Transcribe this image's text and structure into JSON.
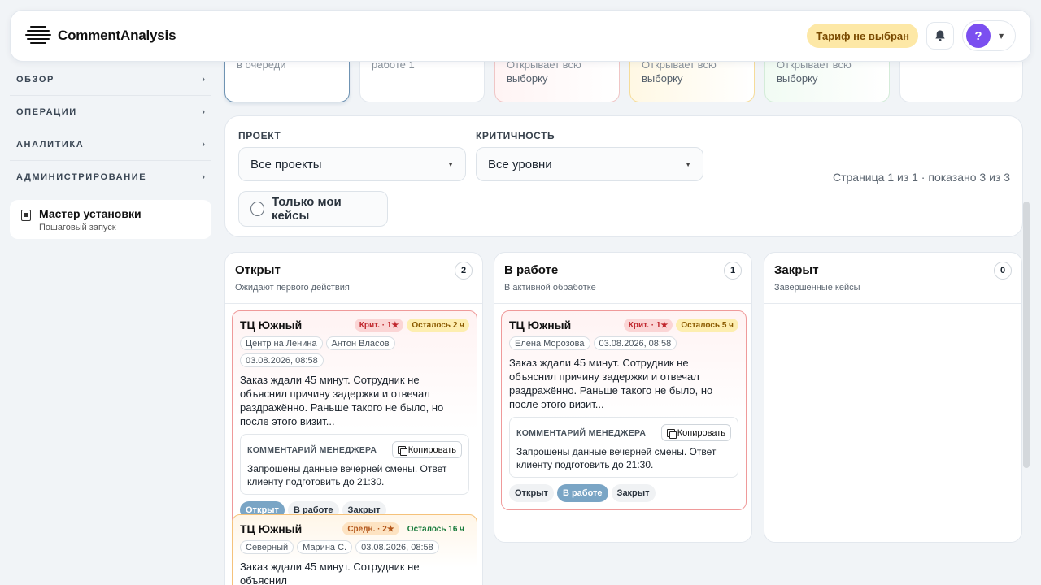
{
  "header": {
    "brand": "CommentAnalysis",
    "tariff": "Тариф не выбран",
    "avatar_letter": "?"
  },
  "sidebar": {
    "items": [
      {
        "label": "ОБЗОР",
        "chevron": "›"
      },
      {
        "label": "ОПЕРАЦИИ",
        "chevron": "›"
      },
      {
        "label": "АНАЛИТИКА",
        "chevron": "›"
      },
      {
        "label": "АДМИНИСТРИРОВАНИЕ",
        "chevron": "›"
      }
    ],
    "wizard": {
      "title": "Мастер установки",
      "subtitle": "Пошаговый запуск"
    }
  },
  "summary_cards": [
    {
      "line1": "в очереди",
      "line2": ""
    },
    {
      "line1": "работе 1",
      "line2": ""
    },
    {
      "line1": "Открывает всю",
      "line2": "выборку"
    },
    {
      "line1": "Открывает всю",
      "line2": "выборку"
    },
    {
      "line1": "Открывает всю",
      "line2": "выборку"
    },
    {
      "line1": "",
      "line2": ""
    }
  ],
  "filters": {
    "project_label": "ПРОЕКТ",
    "project_value": "Все проекты",
    "criticality_label": "КРИТИЧНОСТЬ",
    "criticality_value": "Все уровни",
    "only_mine": "Только мои кейсы",
    "page_info": "Страница 1 из 1 · показано 3 из 3"
  },
  "columns": [
    {
      "title": "Открыт",
      "subtitle": "Ожидают первого действия",
      "count": "2"
    },
    {
      "title": "В работе",
      "subtitle": "В активной обработке",
      "count": "1"
    },
    {
      "title": "Закрыт",
      "subtitle": "Завершенные кейсы",
      "count": "0"
    }
  ],
  "cards": [
    {
      "title": "ТЦ Южный",
      "badge_level": "Крит. · 1★",
      "badge_time": "Осталось 2 ч",
      "tags": [
        "Центр на Ленина",
        "Антон Власов",
        "03.08.2026, 08:58"
      ],
      "text": "Заказ ждали 45 минут. Сотрудник не объяснил причину задержки и отвечал раздражённо. Раньше такого не было, но после этого визит...",
      "comment_label": "КОММЕНТАРИЙ МЕНЕДЖЕРА",
      "copy_label": "Копировать",
      "comment": "Запрошены данные вечерней смены. Ответ клиенту подготовить до 21:30.",
      "statuses": [
        "Открыт",
        "В работе",
        "Закрыт"
      ]
    },
    {
      "title": "ТЦ Южный",
      "badge_level": "Средн. · 2★",
      "badge_time": "Осталось 16 ч",
      "tags": [
        "Северный",
        "Марина С.",
        "03.08.2026, 08:58"
      ],
      "text": "Заказ ждали 45 минут. Сотрудник не объяснил"
    },
    {
      "title": "ТЦ Южный",
      "badge_level": "Крит. · 1★",
      "badge_time": "Осталось 5 ч",
      "tags": [
        "Елена Морозова",
        "03.08.2026, 08:58"
      ],
      "text": "Заказ ждали 45 минут. Сотрудник не объяснил причину задержки и отвечал раздражённо. Раньше такого не было, но после этого визит...",
      "comment_label": "КОММЕНТАРИЙ МЕНЕДЖЕРА",
      "copy_label": "Копировать",
      "comment": "Запрошены данные вечерней смены. Ответ клиенту подготовить до 21:30.",
      "statuses": [
        "Открыт",
        "В работе",
        "Закрыт"
      ]
    }
  ]
}
